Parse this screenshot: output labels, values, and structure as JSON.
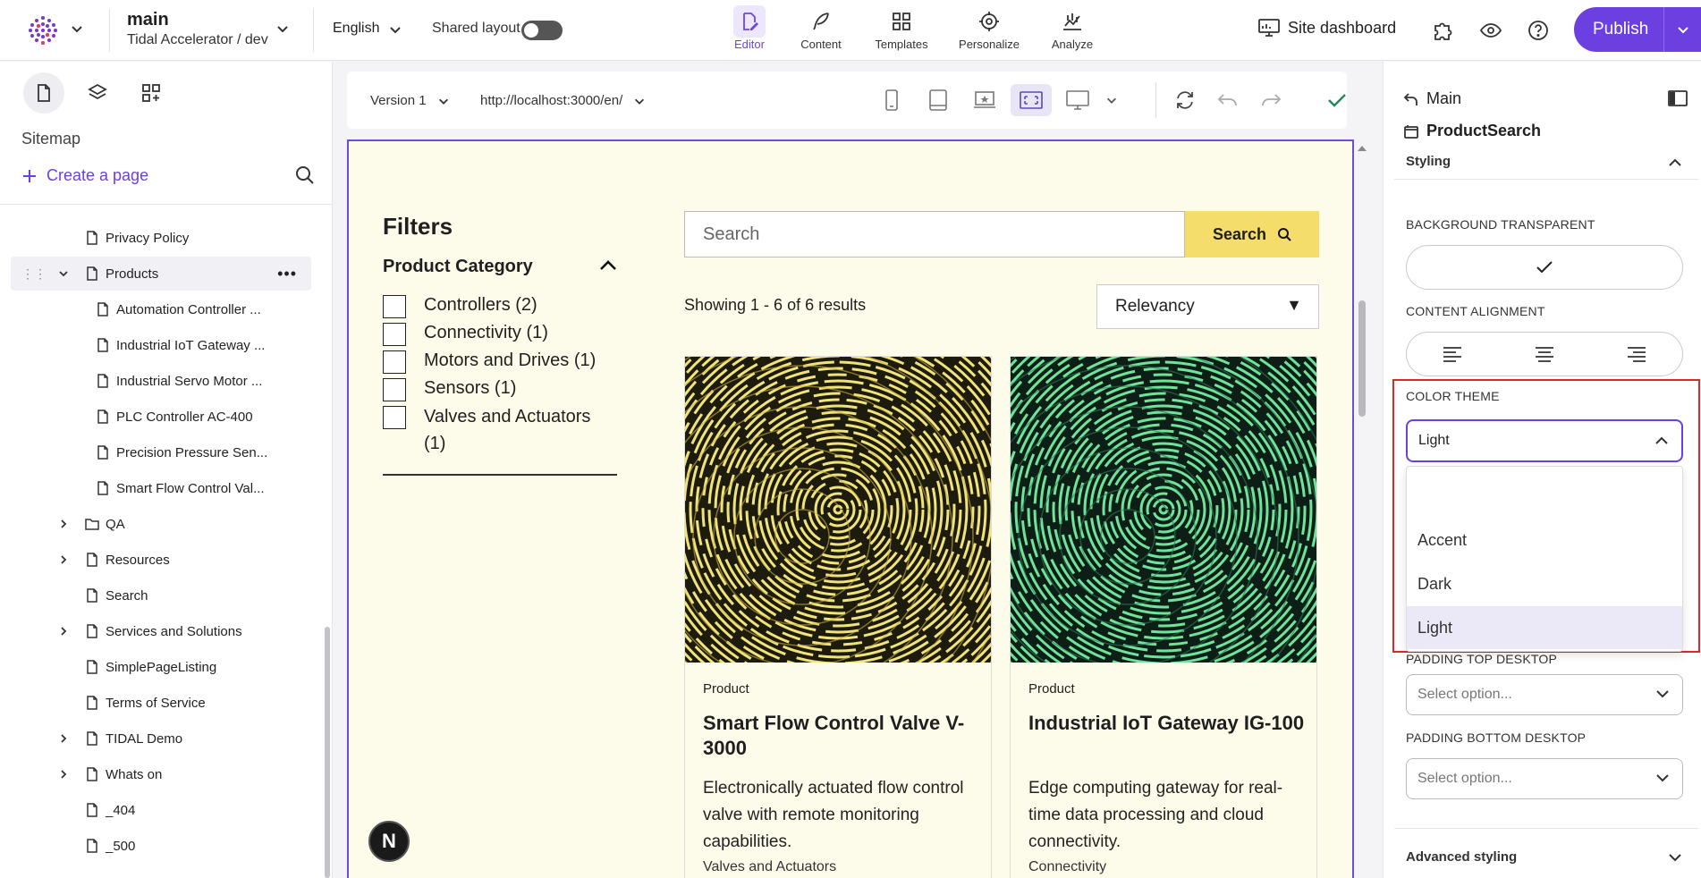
{
  "header": {
    "site_name": "main",
    "site_sub": "Tidal Accelerator / dev",
    "language": "English",
    "shared_layout_label": "Shared layout",
    "shared_layout_on": false,
    "tabs": [
      {
        "label": "Editor",
        "icon": "editor-icon",
        "active": true
      },
      {
        "label": "Content",
        "icon": "feather-icon",
        "active": false
      },
      {
        "label": "Templates",
        "icon": "grid-icon",
        "active": false
      },
      {
        "label": "Personalize",
        "icon": "target-icon",
        "active": false
      },
      {
        "label": "Analyze",
        "icon": "analytics-icon",
        "active": false
      }
    ],
    "site_dashboard": "Site dashboard",
    "publish": "Publish",
    "accent_color": "#6b3fe0"
  },
  "sidebar": {
    "section_title": "Sitemap",
    "create_page": "Create a page",
    "items": [
      {
        "label": "Privacy Policy",
        "type": "page",
        "level": 1
      },
      {
        "label": "Products",
        "type": "page",
        "level": 1,
        "expanded": true,
        "selected": true
      },
      {
        "label": "Automation Controller ...",
        "type": "page",
        "level": 2
      },
      {
        "label": "Industrial IoT Gateway ...",
        "type": "page",
        "level": 2
      },
      {
        "label": "Industrial Servo Motor ...",
        "type": "page",
        "level": 2
      },
      {
        "label": "PLC Controller AC-400",
        "type": "page",
        "level": 2
      },
      {
        "label": "Precision Pressure Sen...",
        "type": "page",
        "level": 2
      },
      {
        "label": "Smart Flow Control Val...",
        "type": "page",
        "level": 2
      },
      {
        "label": "QA",
        "type": "folder",
        "level": 1,
        "collapsed": true
      },
      {
        "label": "Resources",
        "type": "page",
        "level": 1,
        "collapsed": true
      },
      {
        "label": "Search",
        "type": "page",
        "level": 1
      },
      {
        "label": "Services and Solutions",
        "type": "page",
        "level": 1,
        "collapsed": true
      },
      {
        "label": "SimplePageListing",
        "type": "page",
        "level": 1
      },
      {
        "label": "Terms of Service",
        "type": "page",
        "level": 1
      },
      {
        "label": "TIDAL Demo",
        "type": "page",
        "level": 1,
        "collapsed": true
      },
      {
        "label": "Whats on",
        "type": "page",
        "level": 1,
        "collapsed": true
      },
      {
        "label": "_404",
        "type": "page",
        "level": 1
      },
      {
        "label": "_500",
        "type": "page",
        "level": 1
      }
    ]
  },
  "canvas_toolbar": {
    "version": "Version 1",
    "url": "http://localhost:3000/en/"
  },
  "page": {
    "filters_title": "Filters",
    "category_title": "Product Category",
    "categories": [
      {
        "label": "Controllers (2)"
      },
      {
        "label": "Connectivity (1)"
      },
      {
        "label": "Motors and Drives (1)"
      },
      {
        "label": "Sensors (1)"
      },
      {
        "label": "Valves and Actuators (1)"
      }
    ],
    "search_placeholder": "Search",
    "search_button": "Search",
    "showing": "Showing 1 - 6 of 6 results",
    "sort_value": "Relevancy",
    "cards": [
      {
        "type": "Product",
        "title": "Smart Flow Control Valve V-3000",
        "desc": "Electronically actuated flow control valve with remote monitoring capabilities.",
        "category": "Valves and Actuators",
        "palette": "yellow"
      },
      {
        "type": "Product",
        "title": "Industrial IoT Gateway IG-100",
        "desc": "Edge computing gateway for real-time data processing and cloud connectivity.",
        "category": "Connectivity",
        "palette": "green"
      }
    ],
    "badge": "N"
  },
  "right_panel": {
    "back_label": "Main",
    "component": "ProductSearch",
    "styling": "Styling",
    "bg_transparent_label": "BACKGROUND TRANSPARENT",
    "content_alignment_label": "CONTENT ALIGNMENT",
    "color_theme_label": "COLOR THEME",
    "color_theme_value": "Light",
    "color_theme_options": [
      "",
      "Accent",
      "Dark",
      "Light"
    ],
    "padding_top_label": "PADDING TOP DESKTOP",
    "padding_top_placeholder": "Select option...",
    "padding_bottom_label": "PADDING BOTTOM DESKTOP",
    "padding_bottom_placeholder": "Select option...",
    "advanced": "Advanced styling"
  }
}
